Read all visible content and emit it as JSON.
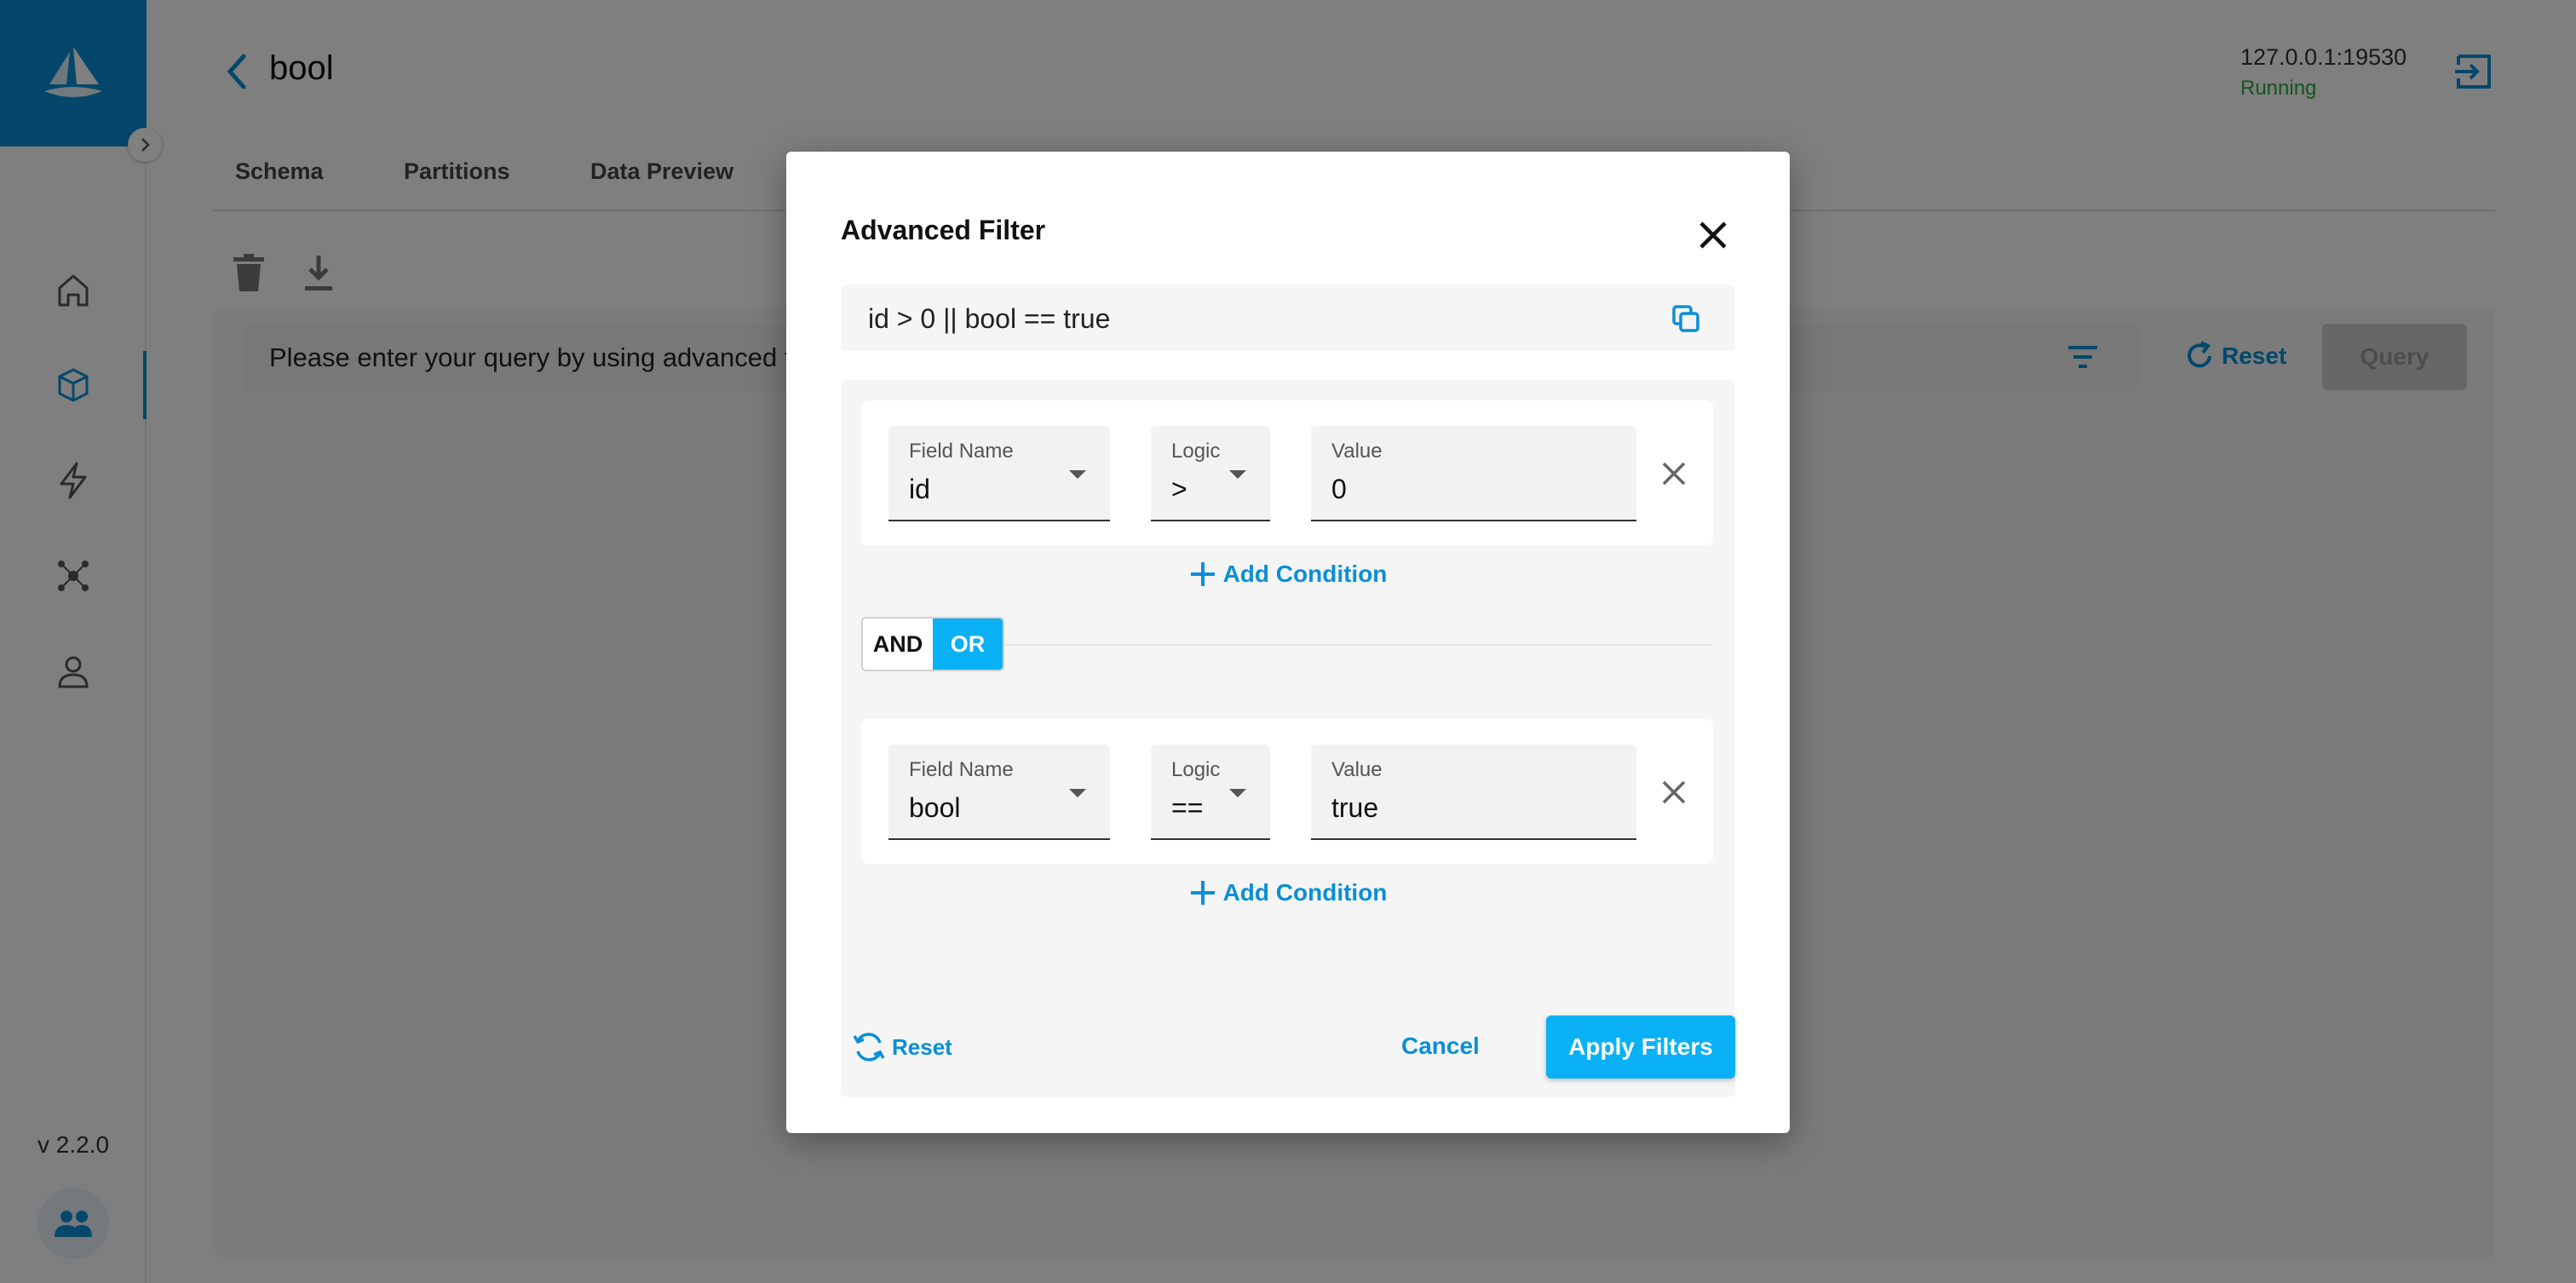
{
  "app": {
    "version": "v 2.2.0",
    "collection_title": "bool",
    "address": "127.0.0.1:19530",
    "status": "Running",
    "tabs": [
      {
        "label": "Schema"
      },
      {
        "label": "Partitions"
      },
      {
        "label": "Data Preview"
      }
    ],
    "query_placeholder": "Please enter your query by using advanced filter",
    "reset_label": "Reset",
    "query_label": "Query",
    "sidebar_icons": [
      "home-icon",
      "collection-icon",
      "bolt-icon",
      "network-icon",
      "user-icon"
    ],
    "accent_color": "#0a8fd6"
  },
  "dialog": {
    "title": "Advanced Filter",
    "expression": "id > 0 || bool == true",
    "groups": [
      {
        "field_label": "Field Name",
        "field_value": "id",
        "logic_label": "Logic",
        "logic_value": ">",
        "value_label": "Value",
        "value_value": "0"
      },
      {
        "field_label": "Field Name",
        "field_value": "bool",
        "logic_label": "Logic",
        "logic_value": "==",
        "value_label": "Value",
        "value_value": "true"
      }
    ],
    "add_condition_label": "Add Condition",
    "logic_toggle": {
      "and_label": "AND",
      "or_label": "OR",
      "selected": "OR"
    },
    "reset_label": "Reset",
    "cancel_label": "Cancel",
    "apply_label": "Apply Filters",
    "button_color": "#0ab1f4"
  }
}
